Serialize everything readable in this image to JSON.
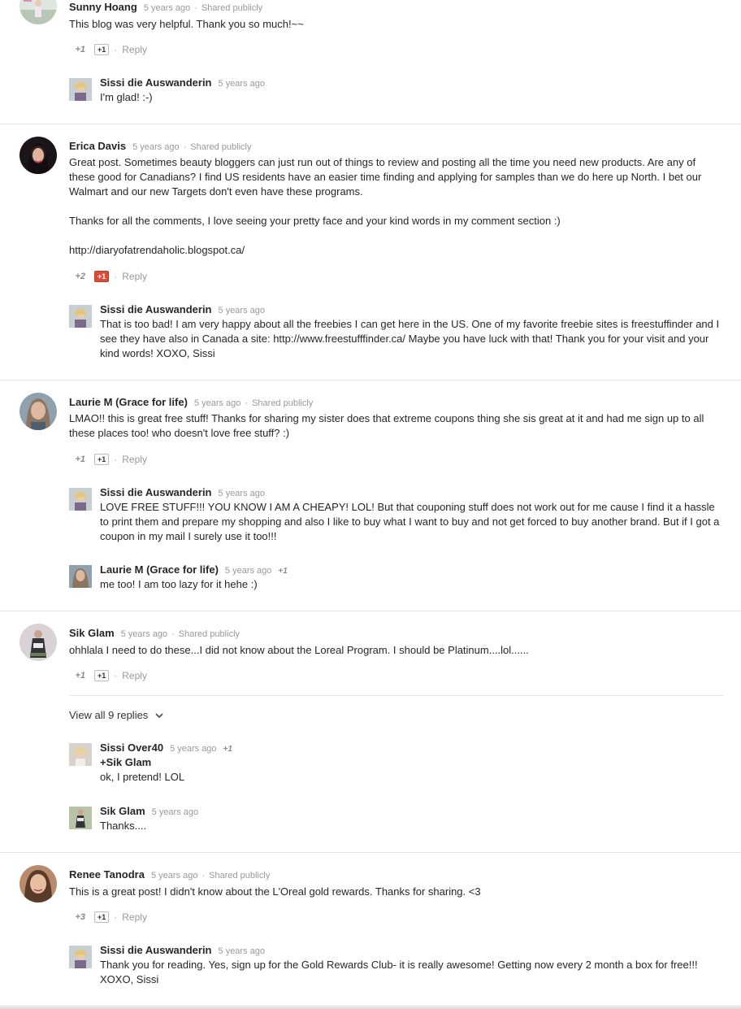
{
  "threads": [
    {
      "author": "Sunny Hoang",
      "time": "5 years ago",
      "visibility": "Shared publicly",
      "text": "This blog was very helpful. Thank you so much!~~",
      "plus_count": "+1",
      "plusone_label": "+1",
      "reply_label": "Reply",
      "replies": [
        {
          "author": "Sissi die Auswanderin",
          "time": "5 years ago",
          "text": "I'm glad! :-)"
        }
      ]
    },
    {
      "author": "Erica Davis",
      "time": "5 years ago",
      "visibility": "Shared publicly",
      "paragraphs": [
        "Great post. Sometimes beauty bloggers can just run out of things to review and posting all the time you need new products. Are any of these good for Canadians? I find US residents have an easier time finding and applying for samples than we do here up North. I bet our Walmart and our new Targets don't even have these programs.",
        "Thanks for all the comments, I love seeing your pretty face and your kind words in my comment section :)",
        "http://diaryofatrendaholic.blogspot.ca/"
      ],
      "plus_count": "+2",
      "plusone_label": "+1",
      "reply_label": "Reply",
      "replies": [
        {
          "author": "Sissi die Auswanderin",
          "time": "5 years ago",
          "text": "That is too bad! I am very happy about all the freebies I can get here in the US. One of my favorite freebie sites is freestuffinder and I see they have also in Canada a site: http://www.freestufffinder.ca/ Maybe you have luck with that! Thank you for your visit and your kind words! XOXO, Sissi"
        }
      ]
    },
    {
      "author": "Laurie M (Grace for life)",
      "time": "5 years ago",
      "visibility": "Shared publicly",
      "text": "LMAO!! this is great free stuff!  Thanks for sharing my sister does that extreme coupons thing she sis great at it and had me sign up to all these places too! who doesn't love free stuff? :)",
      "plus_count": "+1",
      "plusone_label": "+1",
      "reply_label": "Reply",
      "replies": [
        {
          "author": "Sissi die Auswanderin",
          "time": "5 years ago",
          "text": "LOVE FREE STUFF!!! YOU KNOW I AM A CHEAPY! LOL! But that couponing stuff does not work out for me cause I find it a hassle to print them and prepare my shopping and also I like to buy what I want to buy and not get forced to buy another brand. But if I got a coupon in my mail I surely use it too!!!"
        },
        {
          "author": "Laurie M (Grace for life)",
          "time": "5 years ago",
          "plus": "+1",
          "text": "me too! I am too lazy for it hehe :)"
        }
      ]
    },
    {
      "author": "Sik Glam",
      "time": "5 years ago",
      "visibility": "Shared publicly",
      "text": "ohhlala I need to do these...I did not know about the Loreal Program. I should be Platinum....lol......",
      "plus_count": "+1",
      "plusone_label": "+1",
      "reply_label": "Reply",
      "view_all": "View all 9 replies",
      "replies": [
        {
          "author": "Sissi Over40",
          "time": "5 years ago",
          "plus": "+1",
          "mention": "+Sik Glam",
          "text": "ok, I pretend! LOL"
        },
        {
          "author": "Sik Glam",
          "time": "5 years ago",
          "text": "Thanks...."
        }
      ]
    },
    {
      "author": "Renee Tanodra",
      "time": "5 years ago",
      "visibility": "Shared publicly",
      "text": "This is a great post! I didn't know about the L'Oreal gold rewards. Thanks for sharing. <3",
      "plus_count": "+3",
      "plusone_label": "+1",
      "reply_label": "Reply",
      "replies": [
        {
          "author": "Sissi die Auswanderin",
          "time": "5 years ago",
          "text": "Thank you for reading. Yes, sign up for the Gold Rewards Club- it is really awesome! Getting now every 2 month a box for free!!! XOXO, Sissi"
        }
      ]
    }
  ],
  "colors": {
    "plusone_active": "#dd4b39",
    "meta_gray": "#999999",
    "divider": "#e5e5e5"
  },
  "separator": "·"
}
